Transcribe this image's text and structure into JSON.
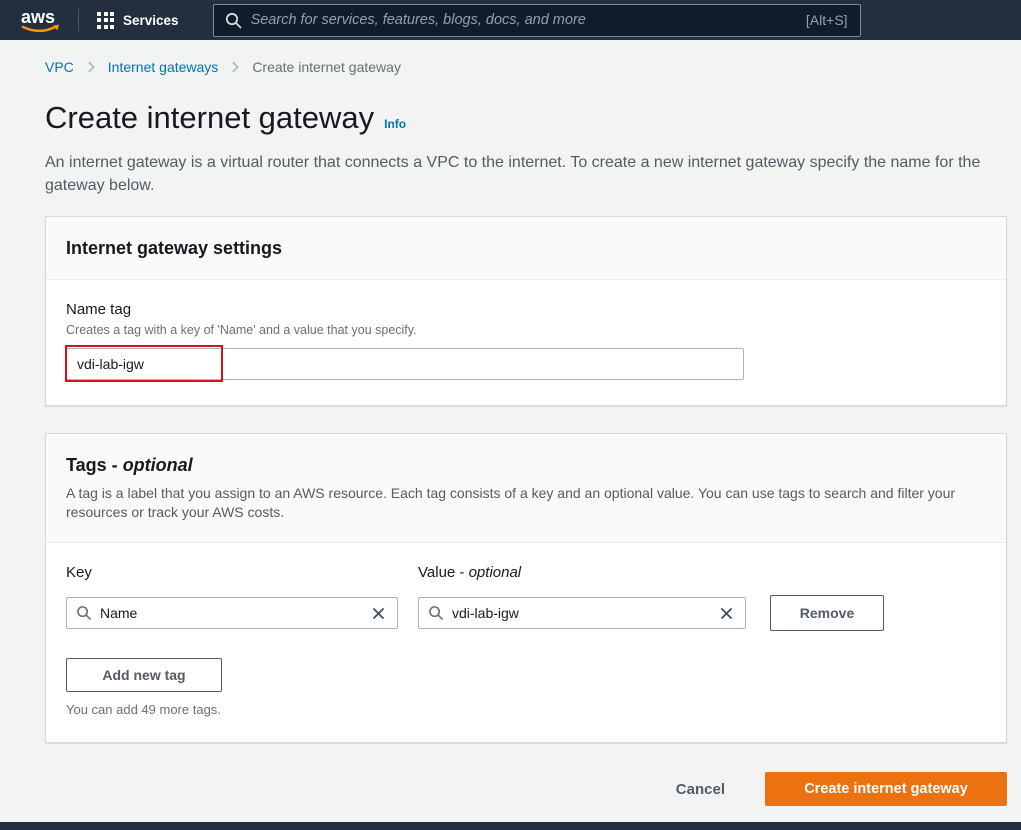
{
  "header": {
    "logo_text": "aws",
    "services_label": "Services",
    "search": {
      "placeholder": "Search for services, features, blogs, docs, and more",
      "shortcut_hint": "[Alt+S]"
    }
  },
  "breadcrumb": {
    "items": [
      {
        "label": "VPC"
      },
      {
        "label": "Internet gateways"
      },
      {
        "label": "Create internet gateway"
      }
    ]
  },
  "page": {
    "title": "Create internet gateway",
    "info_link": "Info",
    "description": "An internet gateway is a virtual router that connects a VPC to the internet. To create a new internet gateway specify the name for the gateway below."
  },
  "settings_card": {
    "title": "Internet gateway settings",
    "name_tag_label": "Name tag",
    "name_tag_hint": "Creates a tag with a key of 'Name' and a value that you specify.",
    "name_tag_value": "vdi-lab-igw"
  },
  "tags_card": {
    "title_prefix": "Tags -",
    "title_optional": "optional",
    "description": "A tag is a label that you assign to an AWS resource. Each tag consists of a key and an optional value. You can use tags to search and filter your resources or track your AWS costs.",
    "key_label": "Key",
    "value_label_prefix": "Value -",
    "value_label_optional": "optional",
    "tag_row": {
      "key": "Name",
      "value": "vdi-lab-igw"
    },
    "remove_button_label": "Remove",
    "add_button_label": "Add new tag",
    "remaining_hint": "You can add 49 more tags."
  },
  "footer": {
    "cancel_label": "Cancel",
    "submit_label": "Create internet gateway"
  },
  "colors": {
    "header_bg": "#232f3e",
    "link_blue": "#0073bb",
    "accent_orange": "#ec7211",
    "annotation_red": "#d8121a",
    "page_bg": "#f2f3f3",
    "card_border": "#d5dbdb"
  }
}
